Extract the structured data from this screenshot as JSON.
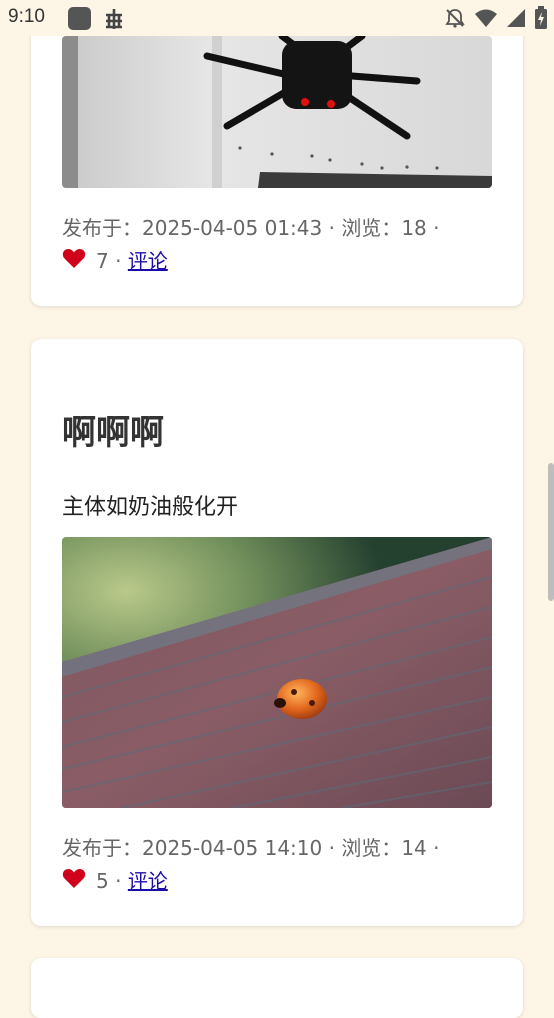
{
  "status_bar": {
    "time": "9:10",
    "icons": [
      "app-icon",
      "bug-icon",
      "notifications-off-icon",
      "wifi-icon",
      "signal-icon",
      "battery-charging-icon"
    ]
  },
  "posts": [
    {
      "image_subject": "spider-robot",
      "meta": {
        "published_label": "发布于：",
        "published_at": "2025-04-05 01:43",
        "views_label": "浏览：",
        "views": "18",
        "separator": "·",
        "likes": "7",
        "comment_label": "评论"
      }
    },
    {
      "title": "啊啊啊",
      "body": "主体如奶油般化开",
      "image_subject": "ladybug-on-railing",
      "meta": {
        "published_label": "发布于：",
        "published_at": "2025-04-05 14:10",
        "views_label": "浏览：",
        "views": "14",
        "separator": "·",
        "likes": "5",
        "comment_label": "评论"
      }
    }
  ],
  "colors": {
    "background": "#fdf6e6",
    "card": "#ffffff",
    "link": "#1a0dab",
    "heart": "#d0021b"
  }
}
